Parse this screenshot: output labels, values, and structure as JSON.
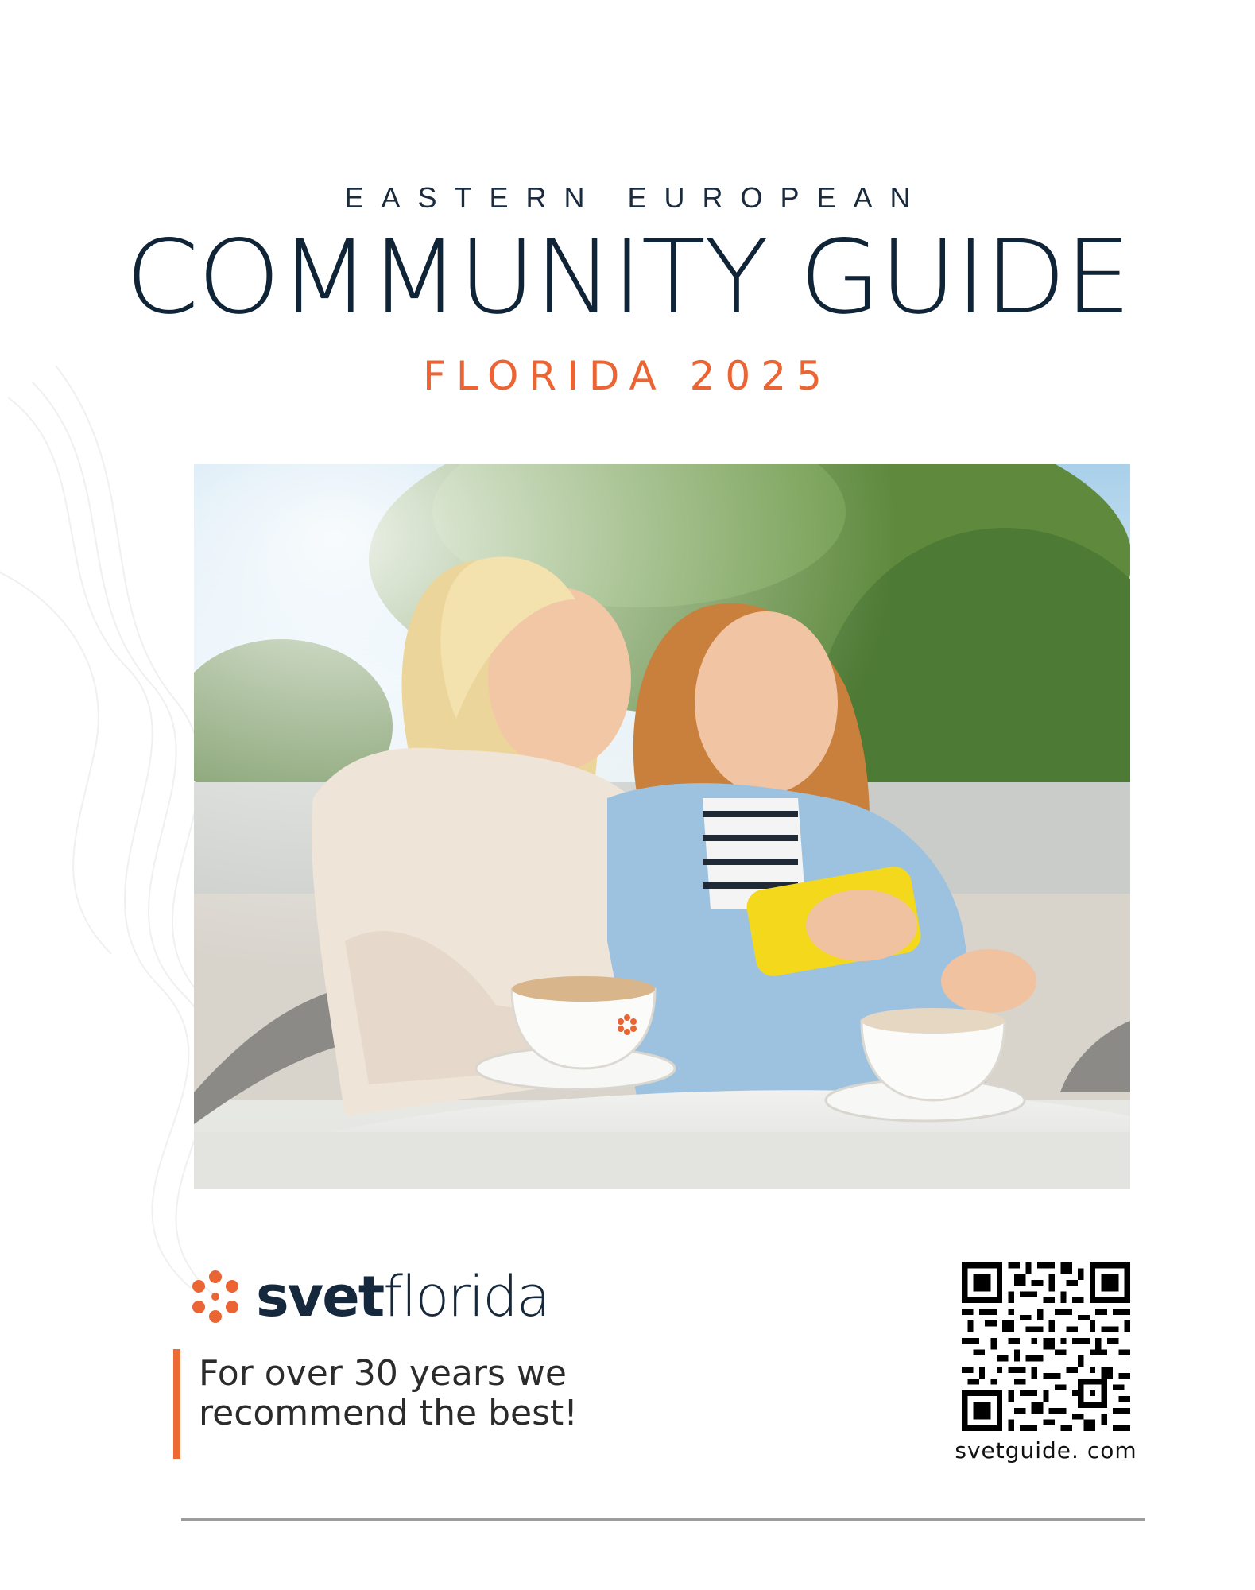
{
  "cover": {
    "kicker": "EASTERN EUROPEAN",
    "title": "COMMUNITY GUIDE",
    "subtitle": "FLORIDA 2025"
  },
  "photo": {
    "kind": "photograph-two-women-at-cafe-table-looking-at-phone"
  },
  "brand": {
    "name_bold": "svet",
    "name_light": "florida",
    "mark_icon": "flower-dots-icon",
    "tagline_line1": "For over 30 years we",
    "tagline_line2": "recommend the best!"
  },
  "qr": {
    "caption": "svetguide. com"
  },
  "colors": {
    "navy": "#0f2436",
    "accent_orange": "#ea6434",
    "rule_gray": "#9c9c9c"
  }
}
